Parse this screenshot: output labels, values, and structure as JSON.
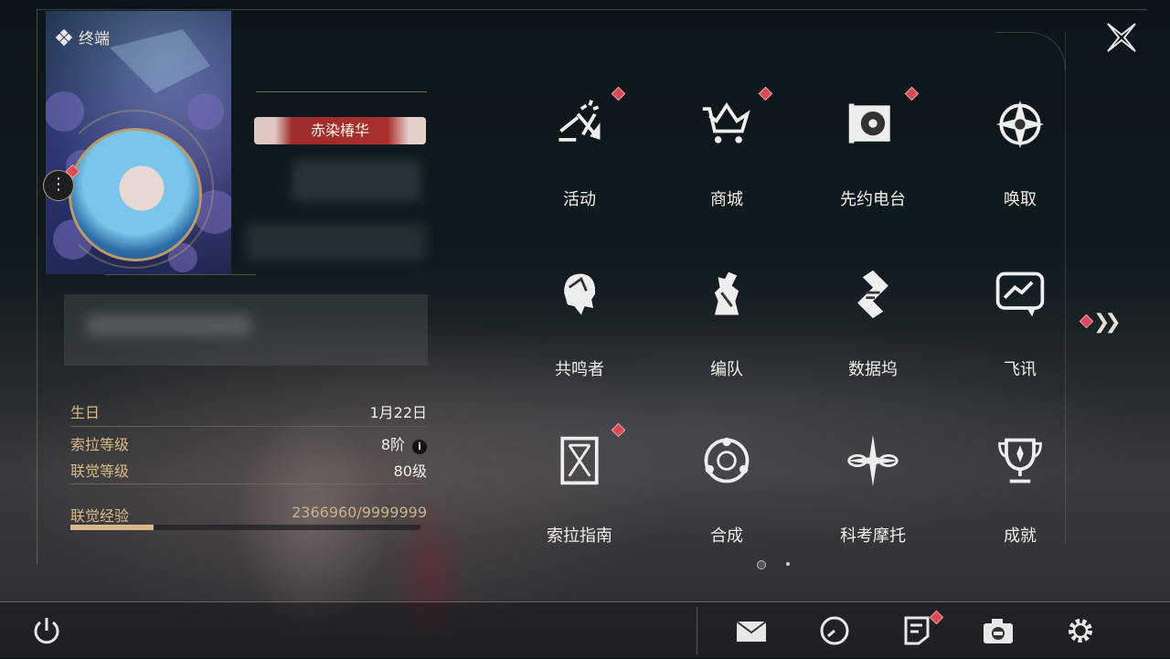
{
  "terminal": {
    "title": "终端",
    "title_tag": "赤染椿华",
    "stats": [
      {
        "label": "生日",
        "value": "1月22日"
      },
      {
        "label": "索拉等级",
        "value": "8阶"
      },
      {
        "label": "联觉等级",
        "value": "80级"
      }
    ],
    "exp": {
      "label": "联觉经验",
      "value": "2366960/9999999",
      "progress": 0.2367
    }
  },
  "menu": {
    "items": [
      {
        "label": "活动",
        "icon": "activity-icon",
        "badge": true
      },
      {
        "label": "商城",
        "icon": "shop-crown-cart-icon",
        "badge": true
      },
      {
        "label": "先约电台",
        "icon": "radio-icon",
        "badge": true
      },
      {
        "label": "唤取",
        "icon": "convene-compass-icon",
        "badge": false
      },
      {
        "label": "共鸣者",
        "icon": "resonator-head-icon",
        "badge": false
      },
      {
        "label": "编队",
        "icon": "chess-team-icon",
        "badge": false
      },
      {
        "label": "数据坞",
        "icon": "data-bank-icon",
        "badge": false
      },
      {
        "label": "飞讯",
        "icon": "message-chat-icon",
        "badge": false
      },
      {
        "label": "索拉指南",
        "icon": "guide-book-icon",
        "badge": true
      },
      {
        "label": "合成",
        "icon": "synthesis-icon",
        "badge": false
      },
      {
        "label": "科考摩托",
        "icon": "motorcycle-icon",
        "badge": false
      },
      {
        "label": "成就",
        "icon": "trophy-icon",
        "badge": false
      }
    ],
    "page_count": 2,
    "current_page": 1
  },
  "toolbar": {
    "items": [
      "mail-icon",
      "clock-icon",
      "notice-icon",
      "camera-icon",
      "settings-gear-icon"
    ]
  },
  "colors": {
    "accent_gold": "#d8b987",
    "badge_red": "#d94a55",
    "title_tag_red": "#a9302d"
  }
}
